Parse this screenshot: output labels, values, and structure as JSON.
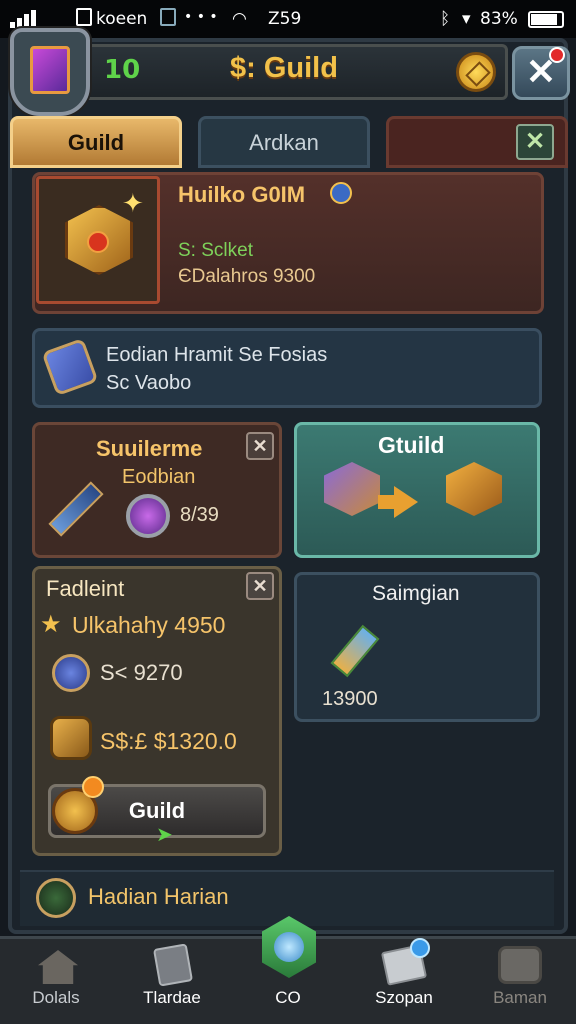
{
  "status_bar": {
    "left_text": "koeen",
    "time": "Z59",
    "battery": "83%"
  },
  "header": {
    "level": "10",
    "title": "$: Guild"
  },
  "tabs": [
    {
      "label": "Guild"
    },
    {
      "label": "Ardkan"
    },
    {
      "label": ""
    }
  ],
  "guild_card": {
    "title": "Huilko G0IM",
    "line1": "S: Sclket",
    "line2": "ЄDalahros 9300"
  },
  "banner": {
    "line1": "Eodian Hramit Se Fosias",
    "line2": "Sc Vaobo"
  },
  "card_l1": {
    "title": "Suuilerme",
    "subtitle": "Eodbian",
    "value": "8/39"
  },
  "card_r1": {
    "title": "Gtuild"
  },
  "card_l2": {
    "title": "Fadleint",
    "rows": [
      {
        "text": "Ulkahahy 4950"
      },
      {
        "text": "S< 9270"
      },
      {
        "text": "S$:£ $1320.0"
      }
    ],
    "button_label": "Guild"
  },
  "card_r2": {
    "title": "Saimgian",
    "value": "13900"
  },
  "bottom_row": {
    "text": "Hadian Harian"
  },
  "bottom_nav": [
    {
      "label": "Dolals",
      "icon": "house-icon"
    },
    {
      "label": "Tlardae",
      "icon": "hammer-icon"
    },
    {
      "label": "CO",
      "icon": "orb-icon"
    },
    {
      "label": "Szopan",
      "icon": "scroll-icon"
    },
    {
      "label": "Baman",
      "icon": "chest-icon"
    }
  ],
  "colors": {
    "gold": "#f2c14a",
    "green": "#5fd34a",
    "teal": "#3c7a72"
  }
}
